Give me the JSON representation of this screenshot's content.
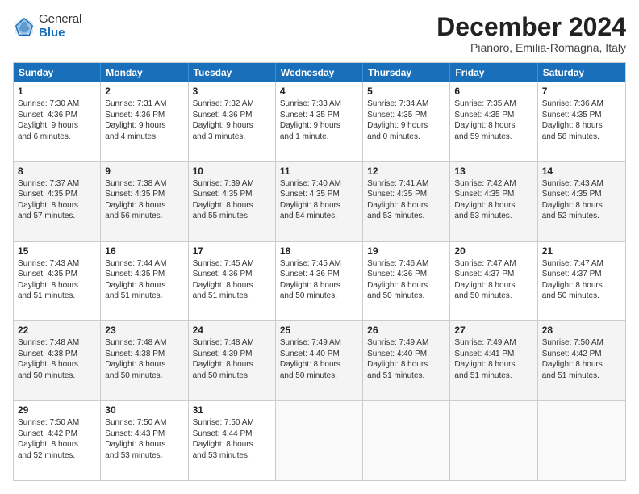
{
  "logo": {
    "general": "General",
    "blue": "Blue"
  },
  "title": "December 2024",
  "location": "Pianoro, Emilia-Romagna, Italy",
  "header_days": [
    "Sunday",
    "Monday",
    "Tuesday",
    "Wednesday",
    "Thursday",
    "Friday",
    "Saturday"
  ],
  "weeks": [
    [
      {
        "day": "1",
        "info": "Sunrise: 7:30 AM\nSunset: 4:36 PM\nDaylight: 9 hours\nand 6 minutes."
      },
      {
        "day": "2",
        "info": "Sunrise: 7:31 AM\nSunset: 4:36 PM\nDaylight: 9 hours\nand 4 minutes."
      },
      {
        "day": "3",
        "info": "Sunrise: 7:32 AM\nSunset: 4:36 PM\nDaylight: 9 hours\nand 3 minutes."
      },
      {
        "day": "4",
        "info": "Sunrise: 7:33 AM\nSunset: 4:35 PM\nDaylight: 9 hours\nand 1 minute."
      },
      {
        "day": "5",
        "info": "Sunrise: 7:34 AM\nSunset: 4:35 PM\nDaylight: 9 hours\nand 0 minutes."
      },
      {
        "day": "6",
        "info": "Sunrise: 7:35 AM\nSunset: 4:35 PM\nDaylight: 8 hours\nand 59 minutes."
      },
      {
        "day": "7",
        "info": "Sunrise: 7:36 AM\nSunset: 4:35 PM\nDaylight: 8 hours\nand 58 minutes."
      }
    ],
    [
      {
        "day": "8",
        "info": "Sunrise: 7:37 AM\nSunset: 4:35 PM\nDaylight: 8 hours\nand 57 minutes."
      },
      {
        "day": "9",
        "info": "Sunrise: 7:38 AM\nSunset: 4:35 PM\nDaylight: 8 hours\nand 56 minutes."
      },
      {
        "day": "10",
        "info": "Sunrise: 7:39 AM\nSunset: 4:35 PM\nDaylight: 8 hours\nand 55 minutes."
      },
      {
        "day": "11",
        "info": "Sunrise: 7:40 AM\nSunset: 4:35 PM\nDaylight: 8 hours\nand 54 minutes."
      },
      {
        "day": "12",
        "info": "Sunrise: 7:41 AM\nSunset: 4:35 PM\nDaylight: 8 hours\nand 53 minutes."
      },
      {
        "day": "13",
        "info": "Sunrise: 7:42 AM\nSunset: 4:35 PM\nDaylight: 8 hours\nand 53 minutes."
      },
      {
        "day": "14",
        "info": "Sunrise: 7:43 AM\nSunset: 4:35 PM\nDaylight: 8 hours\nand 52 minutes."
      }
    ],
    [
      {
        "day": "15",
        "info": "Sunrise: 7:43 AM\nSunset: 4:35 PM\nDaylight: 8 hours\nand 51 minutes."
      },
      {
        "day": "16",
        "info": "Sunrise: 7:44 AM\nSunset: 4:35 PM\nDaylight: 8 hours\nand 51 minutes."
      },
      {
        "day": "17",
        "info": "Sunrise: 7:45 AM\nSunset: 4:36 PM\nDaylight: 8 hours\nand 51 minutes."
      },
      {
        "day": "18",
        "info": "Sunrise: 7:45 AM\nSunset: 4:36 PM\nDaylight: 8 hours\nand 50 minutes."
      },
      {
        "day": "19",
        "info": "Sunrise: 7:46 AM\nSunset: 4:36 PM\nDaylight: 8 hours\nand 50 minutes."
      },
      {
        "day": "20",
        "info": "Sunrise: 7:47 AM\nSunset: 4:37 PM\nDaylight: 8 hours\nand 50 minutes."
      },
      {
        "day": "21",
        "info": "Sunrise: 7:47 AM\nSunset: 4:37 PM\nDaylight: 8 hours\nand 50 minutes."
      }
    ],
    [
      {
        "day": "22",
        "info": "Sunrise: 7:48 AM\nSunset: 4:38 PM\nDaylight: 8 hours\nand 50 minutes."
      },
      {
        "day": "23",
        "info": "Sunrise: 7:48 AM\nSunset: 4:38 PM\nDaylight: 8 hours\nand 50 minutes."
      },
      {
        "day": "24",
        "info": "Sunrise: 7:48 AM\nSunset: 4:39 PM\nDaylight: 8 hours\nand 50 minutes."
      },
      {
        "day": "25",
        "info": "Sunrise: 7:49 AM\nSunset: 4:40 PM\nDaylight: 8 hours\nand 50 minutes."
      },
      {
        "day": "26",
        "info": "Sunrise: 7:49 AM\nSunset: 4:40 PM\nDaylight: 8 hours\nand 51 minutes."
      },
      {
        "day": "27",
        "info": "Sunrise: 7:49 AM\nSunset: 4:41 PM\nDaylight: 8 hours\nand 51 minutes."
      },
      {
        "day": "28",
        "info": "Sunrise: 7:50 AM\nSunset: 4:42 PM\nDaylight: 8 hours\nand 51 minutes."
      }
    ],
    [
      {
        "day": "29",
        "info": "Sunrise: 7:50 AM\nSunset: 4:42 PM\nDaylight: 8 hours\nand 52 minutes."
      },
      {
        "day": "30",
        "info": "Sunrise: 7:50 AM\nSunset: 4:43 PM\nDaylight: 8 hours\nand 53 minutes."
      },
      {
        "day": "31",
        "info": "Sunrise: 7:50 AM\nSunset: 4:44 PM\nDaylight: 8 hours\nand 53 minutes."
      },
      {
        "day": "",
        "info": ""
      },
      {
        "day": "",
        "info": ""
      },
      {
        "day": "",
        "info": ""
      },
      {
        "day": "",
        "info": ""
      }
    ]
  ]
}
